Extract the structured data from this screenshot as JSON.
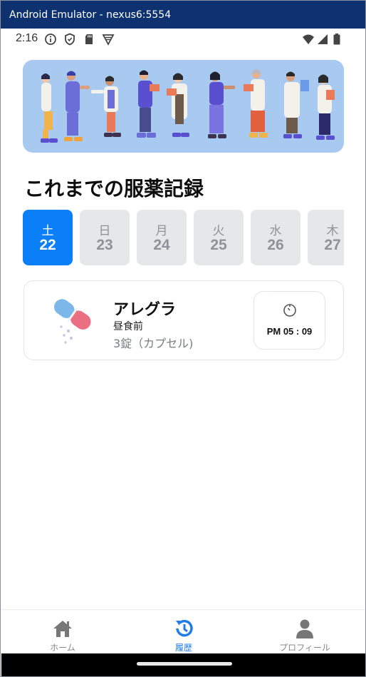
{
  "window": {
    "title": "Android Emulator - nexus6:5554"
  },
  "status_bar": {
    "time": "2:16",
    "left_icons": [
      "info-icon",
      "shield-icon",
      "sd-card-icon",
      "vpn-icon"
    ],
    "right_icons": [
      "wifi-icon",
      "signal-icon",
      "battery-icon"
    ]
  },
  "banner": {
    "illustration": "medical-staff-group"
  },
  "history": {
    "title": "これまでの服薬記録"
  },
  "dates": [
    {
      "weekday": "土",
      "day": "22",
      "active": true
    },
    {
      "weekday": "日",
      "day": "23",
      "active": false
    },
    {
      "weekday": "月",
      "day": "24",
      "active": false
    },
    {
      "weekday": "火",
      "day": "25",
      "active": false
    },
    {
      "weekday": "水",
      "day": "26",
      "active": false
    },
    {
      "weekday": "木",
      "day": "27",
      "active": false
    }
  ],
  "medication": {
    "icon": "capsule-icon",
    "name": "アレグラ",
    "timing": "昼食前",
    "dose": "3錠（カプセル)",
    "time_icon": "timer-icon",
    "time": "PM 05 : 09"
  },
  "nav": {
    "home": "ホーム",
    "history": "履歴",
    "profile": "プロフィール",
    "active": "history"
  },
  "colors": {
    "titlebar": "#0e3170",
    "accent": "#0a7ff7",
    "banner_bg": "#a8caf1",
    "chip_inactive": "#e6e7eb",
    "nav_active": "#1f7cea"
  }
}
